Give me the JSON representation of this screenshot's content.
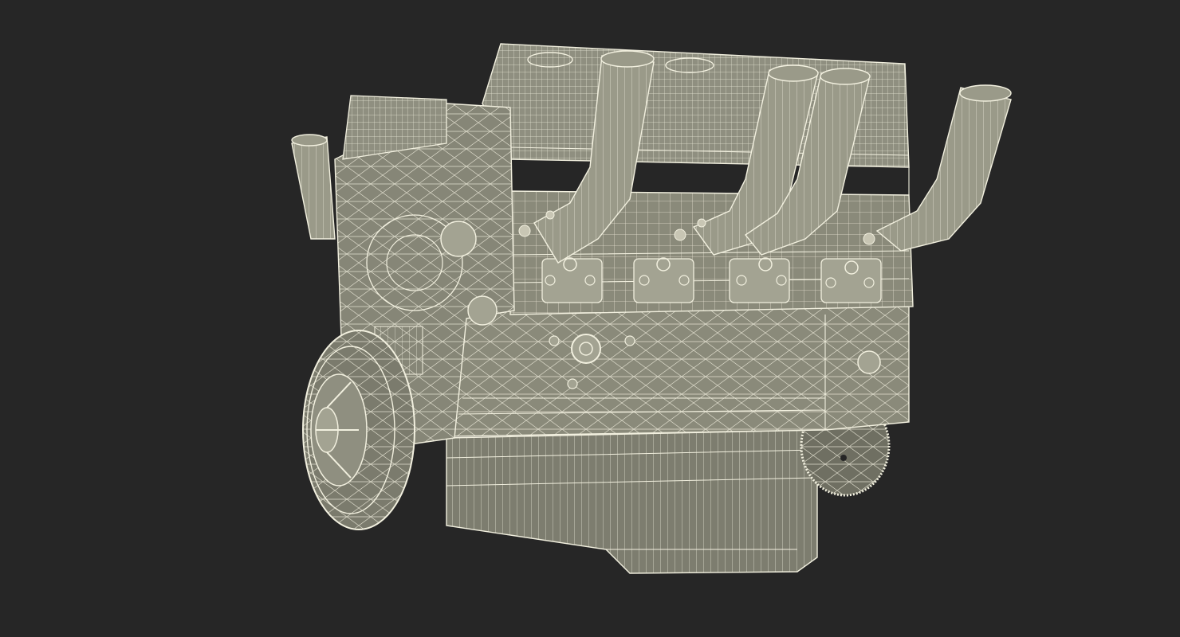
{
  "scene": {
    "background_color": "#262626",
    "surface_color": "#8a8a7a",
    "surface_dark": "#6f6f62",
    "surface_light": "#a3a392",
    "wire_color": "#f2f0df"
  }
}
